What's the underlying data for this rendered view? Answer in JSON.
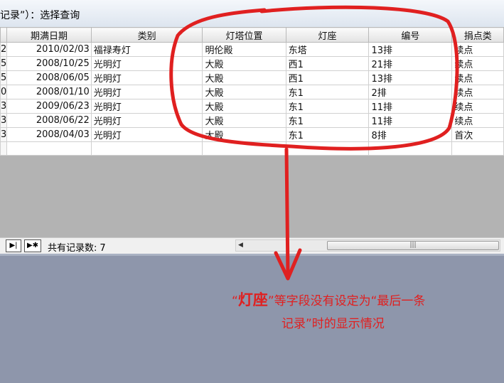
{
  "window": {
    "title": "记录”）：选择查询"
  },
  "columns": [
    "期满日期",
    "类别",
    "灯塔位置",
    "灯座",
    "编号",
    "捐点类"
  ],
  "rows": [
    {
      "rn": "2",
      "date": "2010/02/03",
      "category": "福禄寿灯",
      "tower": "明伦殿",
      "seat": "东塔",
      "number": "13排",
      "donation": "续点"
    },
    {
      "rn": "5",
      "date": "2008/10/25",
      "category": "光明灯",
      "tower": "大殿",
      "seat": "西1",
      "number": "21排",
      "donation": "续点"
    },
    {
      "rn": "5",
      "date": "2008/06/05",
      "category": "光明灯",
      "tower": "大殿",
      "seat": "西1",
      "number": "13排",
      "donation": "续点"
    },
    {
      "rn": "0",
      "date": "2008/01/10",
      "category": "光明灯",
      "tower": "大殿",
      "seat": "东1",
      "number": "2排",
      "donation": "续点"
    },
    {
      "rn": "3",
      "date": "2009/06/23",
      "category": "光明灯",
      "tower": "大殿",
      "seat": "东1",
      "number": "11排",
      "donation": "续点"
    },
    {
      "rn": "3",
      "date": "2008/06/22",
      "category": "光明灯",
      "tower": "大殿",
      "seat": "东1",
      "number": "11排",
      "donation": "续点"
    },
    {
      "rn": "3",
      "date": "2008/04/03",
      "category": "光明灯",
      "tower": "大殿",
      "seat": "东1",
      "number": "8排",
      "donation": "首次"
    }
  ],
  "navigator": {
    "last_icon": "▶|",
    "new_icon": "▶✱",
    "count_label": "共有记录数:",
    "count_value": "7"
  },
  "scrollbar": {
    "left_arrow": "◀",
    "thumb_grip": "|||"
  },
  "annotation": {
    "color": "#e02020",
    "quote_open": "“",
    "field": "灯座",
    "quote_close": "”",
    "line1_rest": "等字段没有设定为“最后一条",
    "line2": "记录”时的显示情况"
  }
}
